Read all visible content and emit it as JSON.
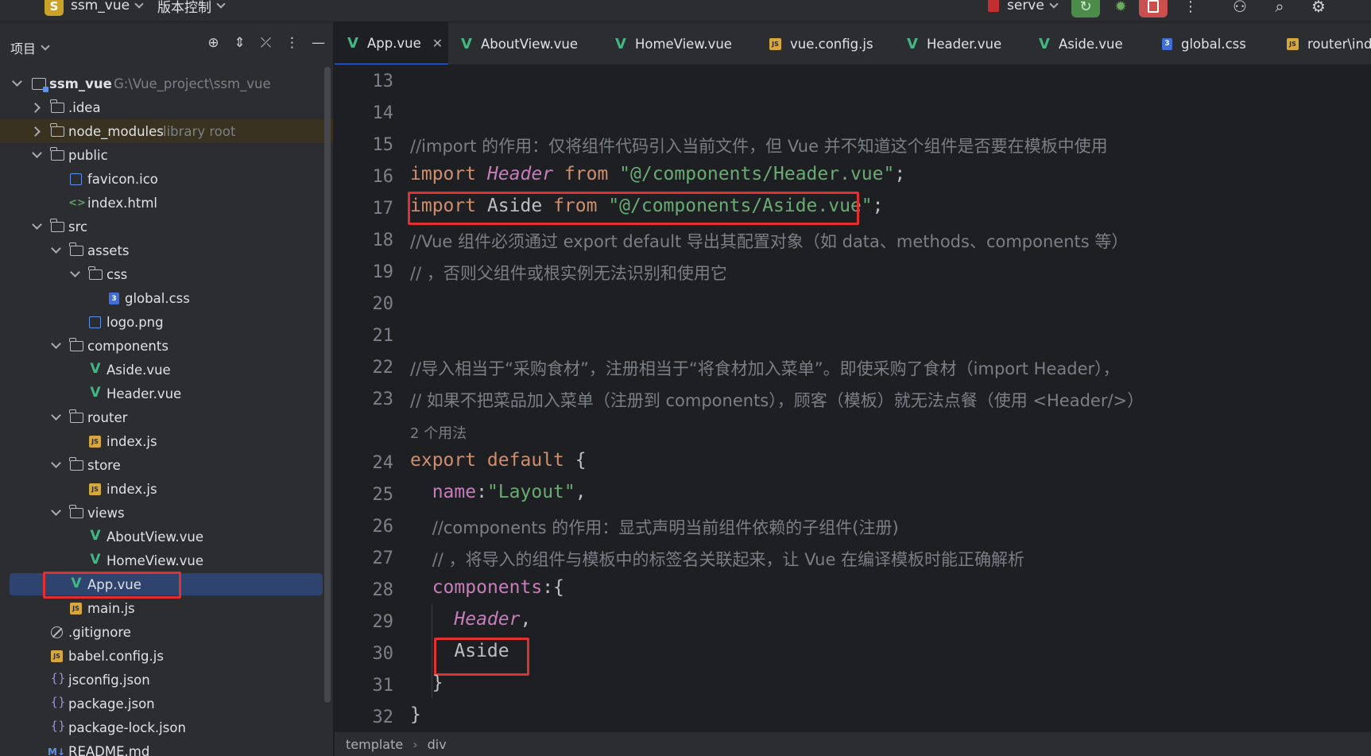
{
  "topbar": {
    "project_badge": "S",
    "project_name": "ssm_vue",
    "vcs_label": "版本控制",
    "run_config": "serve"
  },
  "sidebar": {
    "title": "项目",
    "tree": [
      {
        "label": "ssm_vue",
        "hint": "G:\\Vue_project\\ssm_vue"
      },
      {
        "label": ".idea"
      },
      {
        "label": "node_modules",
        "hint": "library root"
      },
      {
        "label": "public"
      },
      {
        "label": "favicon.ico"
      },
      {
        "label": "index.html"
      },
      {
        "label": "src"
      },
      {
        "label": "assets"
      },
      {
        "label": "css"
      },
      {
        "label": "global.css"
      },
      {
        "label": "logo.png"
      },
      {
        "label": "components"
      },
      {
        "label": "Aside.vue"
      },
      {
        "label": "Header.vue"
      },
      {
        "label": "router"
      },
      {
        "label": "index.js"
      },
      {
        "label": "store"
      },
      {
        "label": "index.js"
      },
      {
        "label": "views"
      },
      {
        "label": "AboutView.vue"
      },
      {
        "label": "HomeView.vue"
      },
      {
        "label": "App.vue"
      },
      {
        "label": "main.js"
      },
      {
        "label": ".gitignore"
      },
      {
        "label": "babel.config.js"
      },
      {
        "label": "jsconfig.json"
      },
      {
        "label": "package.json"
      },
      {
        "label": "package-lock.json"
      },
      {
        "label": "README.md"
      }
    ]
  },
  "tabs": [
    {
      "label": "App.vue",
      "type": "vue",
      "active": true
    },
    {
      "label": "AboutView.vue",
      "type": "vue"
    },
    {
      "label": "HomeView.vue",
      "type": "vue"
    },
    {
      "label": "vue.config.js",
      "type": "js"
    },
    {
      "label": "Header.vue",
      "type": "vue"
    },
    {
      "label": "Aside.vue",
      "type": "vue"
    },
    {
      "label": "global.css",
      "type": "css"
    },
    {
      "label": "router\\index.js",
      "type": "js"
    }
  ],
  "editor": {
    "line_numbers": [
      "13",
      "14",
      "15",
      "16",
      "17",
      "18",
      "19",
      "20",
      "21",
      "22",
      "23",
      "24",
      "25",
      "26",
      "27",
      "28",
      "29",
      "30",
      "31",
      "32"
    ],
    "usages_hint": "2 个用法",
    "lines": {
      "l15": "//import 的作用：仅将组件代码引入当前文件，但 Vue 并不知道这个组件是否要在模板中使用",
      "l16_kw": "import",
      "l16_cls": "Header",
      "l16_from": "from",
      "l16_str": "\"@/components/Header.vue\"",
      "l17_kw": "import",
      "l17_name": "Aside",
      "l17_from": "from",
      "l17_str": "\"@/components/Aside.vue\"",
      "l18": "//Vue 组件必须通过 export default 导出其配置对象（如 data、methods、components 等）",
      "l19": "// ，否则父组件或根实例无法识别和使用它",
      "l22": "//导入相当于“采购食材”，注册相当于“将食材加入菜单”。即使采购了食材（import Header），",
      "l23": "// 如果不把菜品加入菜单（注册到 components），顾客（模板）就无法点餐（使用 <Header/>）",
      "l24_kw": "export default",
      "l24_brace": " {",
      "l25_prop": "name",
      "l25_str": "\"Layout\"",
      "l26": "//components 的作用：显式声明当前组件依赖的子组件(注册)",
      "l27": "// ，将导入的组件与模板中的标签名关联起来，让 Vue 在编译模板时能正确解析",
      "l28_prop": "components",
      "l28_rest": ":{",
      "l29_cls": "Header",
      "l30_name": "Aside",
      "l31": "}",
      "l32": "}"
    }
  },
  "breadcrumb": [
    "template",
    "div"
  ]
}
